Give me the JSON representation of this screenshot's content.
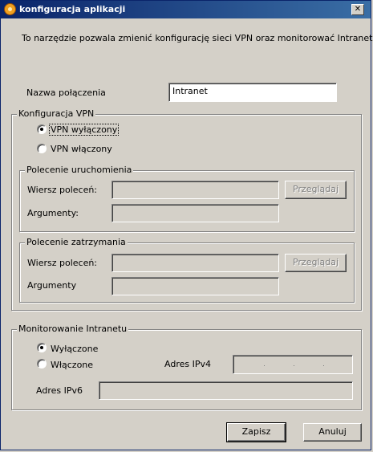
{
  "window": {
    "title": "konfiguracja aplikacji",
    "close_symbol": "✕"
  },
  "intro": "To narzędzie pozwala zmienić konfigurację sieci VPN oraz monitorować Intranet.",
  "connection": {
    "label": "Nazwa połączenia",
    "value": "Intranet"
  },
  "vpn": {
    "group_title": "Konfiguracja VPN",
    "options": [
      "VPN wyłączony",
      "VPN włączony"
    ],
    "selected": "VPN wyłączony",
    "start": {
      "group_title": "Polecenie uruchomienia",
      "command_label": "Wiersz poleceń:",
      "args_label": "Argumenty:",
      "browse_label": "Przeglądaj"
    },
    "stop": {
      "group_title": "Polecenie zatrzymania",
      "command_label": "Wiersz poleceń:",
      "args_label": "Argumenty",
      "browse_label": "Przeglądaj"
    }
  },
  "monitoring": {
    "group_title": "Monitorowanie Intranetu",
    "options": [
      "Wyłączone",
      "Włączone"
    ],
    "selected": "Wyłączone",
    "ipv4_label": "Adres IPv4",
    "ipv6_label": "Adres IPv6"
  },
  "buttons": {
    "save": "Zapisz",
    "cancel": "Anuluj"
  }
}
